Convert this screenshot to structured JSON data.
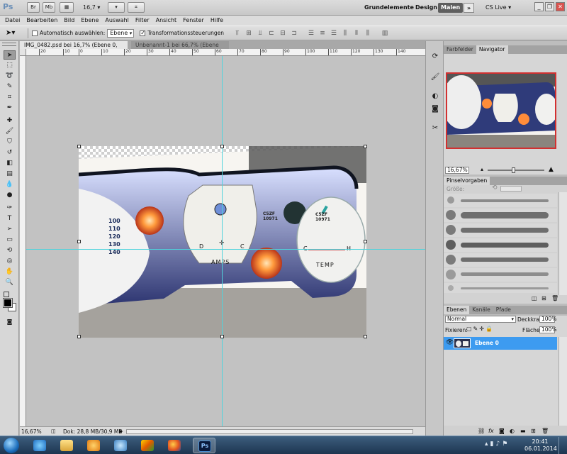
{
  "app": {
    "logo": "Ps",
    "zoom": "16,7",
    "workspaces": [
      "Grundelemente",
      "Design",
      "Malen"
    ],
    "active_workspace": "Malen",
    "more": "»",
    "cs_live": "CS Live ▾",
    "window_controls": [
      "_",
      "❐",
      "✕"
    ]
  },
  "toolbar_icons": [
    {
      "label": "Br",
      "icon": "bridge-icon"
    },
    {
      "label": "Mb",
      "icon": "minibridge-icon"
    },
    {
      "label": "▦",
      "icon": "grid-icon"
    },
    {
      "label": "▾",
      "icon": "arrange-icon"
    },
    {
      "label": "✋",
      "icon": "hand-icon"
    },
    {
      "label": "🔍",
      "icon": "zoom-icon"
    },
    {
      "label": "⌗",
      "icon": "screen-mode-icon"
    }
  ],
  "menu": [
    "Datei",
    "Bearbeiten",
    "Bild",
    "Ebene",
    "Auswahl",
    "Filter",
    "Ansicht",
    "Fenster",
    "Hilfe"
  ],
  "options": {
    "auto_select_label": "Automatisch auswählen:",
    "auto_select_value": "Ebene",
    "transform_label": "Transformationssteuerungen"
  },
  "tabs": [
    {
      "label": "IMG_0482.psd bei 16,7% (Ebene 0, RGB/8)",
      "close": "×"
    },
    {
      "label": "Unbenannt-1 bei 66,7% (Ebene 0, RGB/8)",
      "close": "×"
    }
  ],
  "ruler_h": [
    "20",
    "10",
    "0",
    "10",
    "20",
    "30",
    "40",
    "50",
    "60",
    "70",
    "80",
    "90",
    "100",
    "110",
    "120",
    "130",
    "140"
  ],
  "status": {
    "zoom": "16,67%",
    "doc": "Dok: 28,8 MB/30,9 MB"
  },
  "navigator": {
    "tabs": [
      "Farbfelder",
      "Navigator"
    ],
    "zoom": "16,67%"
  },
  "brushes": {
    "title": "Pinselvorgaben",
    "size_label": "Größe:"
  },
  "layers": {
    "tabs": [
      "Ebenen",
      "Kanäle",
      "Pfade"
    ],
    "blend_mode": "Normal",
    "opacity_label": "Deckkraft:",
    "opacity_value": "100%",
    "lock_label": "Fixieren:",
    "fill_label": "Fläche:",
    "fill_value": "100%",
    "layer_name": "Ebene 0"
  },
  "gauge": {
    "amps_label": "AMPS",
    "temp_label": "TEMP",
    "code_1": "C5ZF",
    "code_2": "10971",
    "d": "D",
    "c": "C",
    "c2": "C",
    "h": "H",
    "speedo_numbers": [
      "100",
      "110",
      "120",
      "130",
      "140"
    ]
  },
  "taskbar": {
    "time": "20:41",
    "date": "06.01.2014"
  },
  "colors": {
    "accent_blue": "#3d9bf0",
    "guide_cyan": "#4fd3dc",
    "nav_frame": "#d23030"
  }
}
